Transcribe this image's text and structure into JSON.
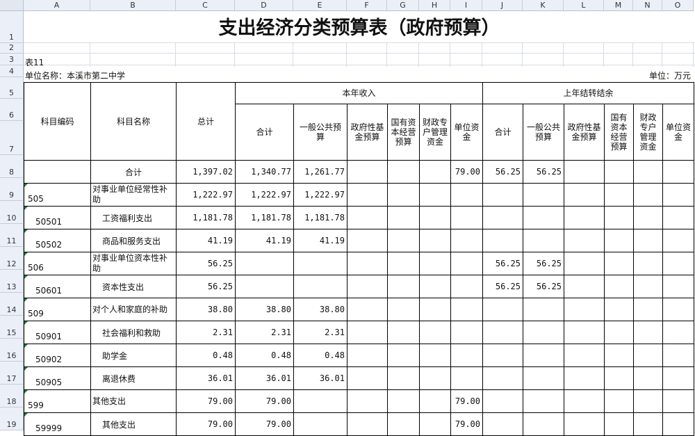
{
  "column_headers": [
    "A",
    "B",
    "C",
    "D",
    "E",
    "F",
    "G",
    "H",
    "I",
    "J",
    "K",
    "L",
    "M",
    "N",
    "O"
  ],
  "row_headers": [
    "1",
    "2",
    "3",
    "4",
    "5",
    "6",
    "7",
    "8",
    "9",
    "10",
    "11",
    "12",
    "13",
    "14",
    "15",
    "16",
    "17",
    "18",
    "19"
  ],
  "title": "支出经济分类预算表（政府预算）",
  "table_no": "表11",
  "unit_name": "单位名称：本溪市第二中学",
  "unit": "单位：万元",
  "headers": {
    "code": "科目编码",
    "name": "科目名称",
    "total": "总计",
    "this_year": "本年收入",
    "last_year": "上年结转结余",
    "sub": [
      "合计",
      "一般公共预算",
      "政府性基金预算",
      "国有资本经营预算",
      "财政专户管理资金",
      "单位资金",
      "合计",
      "一般公共预算",
      "政府性基金预算",
      "国有资本经营预算",
      "财政专户管理资金",
      "单位资金"
    ]
  },
  "rows": [
    {
      "code": "",
      "name": "合计",
      "total": "1,397.02",
      "c1": "1,340.77",
      "c2": "1,261.77",
      "c3": "",
      "c4": "",
      "c5": "",
      "c6": "79.00",
      "c7": "56.25",
      "c8": "56.25",
      "c9": "",
      "c10": "",
      "c11": "",
      "c12": ""
    },
    {
      "code": "505",
      "name": "对事业单位经常性补助",
      "total": "1,222.97",
      "c1": "1,222.97",
      "c2": "1,222.97",
      "c3": "",
      "c4": "",
      "c5": "",
      "c6": "",
      "c7": "",
      "c8": "",
      "c9": "",
      "c10": "",
      "c11": "",
      "c12": ""
    },
    {
      "code": "50501",
      "name": "工资福利支出",
      "total": "1,181.78",
      "c1": "1,181.78",
      "c2": "1,181.78",
      "c3": "",
      "c4": "",
      "c5": "",
      "c6": "",
      "c7": "",
      "c8": "",
      "c9": "",
      "c10": "",
      "c11": "",
      "c12": ""
    },
    {
      "code": "50502",
      "name": "商品和服务支出",
      "total": "41.19",
      "c1": "41.19",
      "c2": "41.19",
      "c3": "",
      "c4": "",
      "c5": "",
      "c6": "",
      "c7": "",
      "c8": "",
      "c9": "",
      "c10": "",
      "c11": "",
      "c12": ""
    },
    {
      "code": "506",
      "name": "对事业单位资本性补助",
      "total": "56.25",
      "c1": "",
      "c2": "",
      "c3": "",
      "c4": "",
      "c5": "",
      "c6": "",
      "c7": "56.25",
      "c8": "56.25",
      "c9": "",
      "c10": "",
      "c11": "",
      "c12": ""
    },
    {
      "code": "50601",
      "name": "资本性支出",
      "total": "56.25",
      "c1": "",
      "c2": "",
      "c3": "",
      "c4": "",
      "c5": "",
      "c6": "",
      "c7": "56.25",
      "c8": "56.25",
      "c9": "",
      "c10": "",
      "c11": "",
      "c12": ""
    },
    {
      "code": "509",
      "name": "对个人和家庭的补助",
      "total": "38.80",
      "c1": "38.80",
      "c2": "38.80",
      "c3": "",
      "c4": "",
      "c5": "",
      "c6": "",
      "c7": "",
      "c8": "",
      "c9": "",
      "c10": "",
      "c11": "",
      "c12": ""
    },
    {
      "code": "50901",
      "name": "社会福利和救助",
      "total": "2.31",
      "c1": "2.31",
      "c2": "2.31",
      "c3": "",
      "c4": "",
      "c5": "",
      "c6": "",
      "c7": "",
      "c8": "",
      "c9": "",
      "c10": "",
      "c11": "",
      "c12": ""
    },
    {
      "code": "50902",
      "name": "助学金",
      "total": "0.48",
      "c1": "0.48",
      "c2": "0.48",
      "c3": "",
      "c4": "",
      "c5": "",
      "c6": "",
      "c7": "",
      "c8": "",
      "c9": "",
      "c10": "",
      "c11": "",
      "c12": ""
    },
    {
      "code": "50905",
      "name": "离退休费",
      "total": "36.01",
      "c1": "36.01",
      "c2": "36.01",
      "c3": "",
      "c4": "",
      "c5": "",
      "c6": "",
      "c7": "",
      "c8": "",
      "c9": "",
      "c10": "",
      "c11": "",
      "c12": ""
    },
    {
      "code": "599",
      "name": "其他支出",
      "total": "79.00",
      "c1": "79.00",
      "c2": "",
      "c3": "",
      "c4": "",
      "c5": "",
      "c6": "79.00",
      "c7": "",
      "c8": "",
      "c9": "",
      "c10": "",
      "c11": "",
      "c12": ""
    },
    {
      "code": "59999",
      "name": "其他支出",
      "total": "79.00",
      "c1": "79.00",
      "c2": "",
      "c3": "",
      "c4": "",
      "c5": "",
      "c6": "79.00",
      "c7": "",
      "c8": "",
      "c9": "",
      "c10": "",
      "c11": "",
      "c12": ""
    }
  ]
}
